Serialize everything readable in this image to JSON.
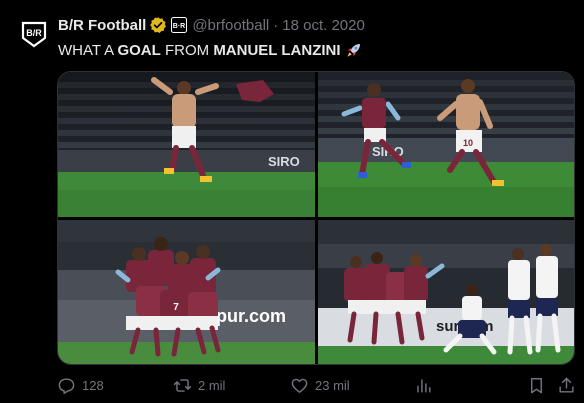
{
  "tweet": {
    "display_name": "B/R Football",
    "handle": "@brfootball",
    "separator": "·",
    "date": "18 oct. 2020",
    "avatar_text": "B/R",
    "text": {
      "part1": "WHAT A ",
      "part2": "GOAL",
      "part3": " FROM ",
      "part4": "MANUEL LANZINI"
    }
  },
  "media": {
    "photo_1": {
      "banner": "SIRO"
    },
    "photo_2": {
      "banner": "SIRO"
    },
    "photo_3": {
      "banner": "hotspur.com"
    },
    "photo_4": {
      "banner": "sur.com"
    }
  },
  "actions": {
    "replies": "128",
    "retweets": "2 mil",
    "likes": "23 mil",
    "views": ""
  },
  "icons": {
    "reply": "reply-icon",
    "retweet": "retweet-icon",
    "like": "heart-icon",
    "views": "views-icon",
    "bookmark": "bookmark-icon",
    "share": "share-icon",
    "verified": "verified-badge-icon",
    "rocket": "rocket-icon"
  },
  "colors": {
    "background": "#000000",
    "text": "#e7e9ea",
    "secondary": "#71767b",
    "verified_gold": "#e2b719",
    "west_ham_claret": "#7a263a",
    "west_ham_blue": "#8bb7d9"
  }
}
